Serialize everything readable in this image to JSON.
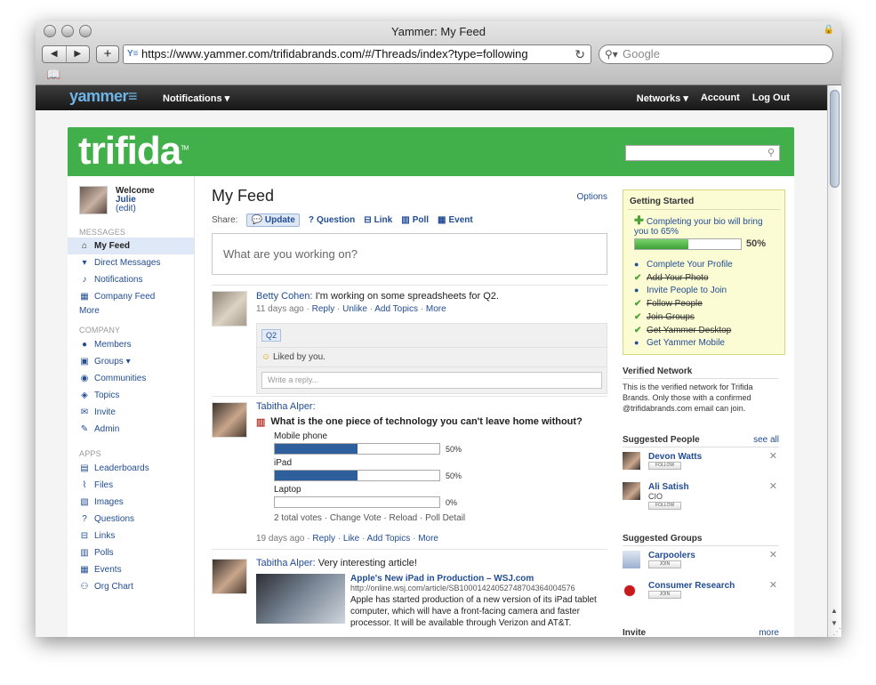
{
  "window": {
    "title": "Yammer: My Feed"
  },
  "browser": {
    "url": "https://www.yammer.com/trifidabrands.com/#/Threads/index?type=following",
    "search_placeholder": "Google",
    "back_label": "◀",
    "forward_label": "▶",
    "add_label": "+",
    "favicon_label": "Y≡",
    "reload_label": "↻",
    "bookmarks_label": "📖"
  },
  "topbar": {
    "logo": "yammer≡",
    "notifications": "Notifications ▾",
    "networks": "Networks ▾",
    "account": "Account",
    "logout": "Log Out"
  },
  "banner": {
    "brand": "trifida",
    "tm": "TM"
  },
  "user": {
    "welcome": "Welcome",
    "name": "Julie",
    "edit": "(edit)"
  },
  "sidebar": {
    "messages_header": "MESSAGES",
    "messages": [
      {
        "label": "My Feed",
        "icon": "house-icon",
        "glyph": "⌂"
      },
      {
        "label": "Direct Messages",
        "icon": "inbox-icon",
        "glyph": "▾"
      },
      {
        "label": "Notifications",
        "icon": "bell-icon",
        "glyph": "♪"
      },
      {
        "label": "Company Feed",
        "icon": "building-icon",
        "glyph": "▦"
      }
    ],
    "messages_more": "More",
    "company_header": "COMPANY",
    "company": [
      {
        "label": "Members",
        "icon": "person-icon",
        "glyph": "●"
      },
      {
        "label": "Groups ▾",
        "icon": "groups-icon",
        "glyph": "▣"
      },
      {
        "label": "Communities",
        "icon": "globe-icon",
        "glyph": "◉"
      },
      {
        "label": "Topics",
        "icon": "tag-icon",
        "glyph": "◈"
      },
      {
        "label": "Invite",
        "icon": "envelope-icon",
        "glyph": "✉"
      },
      {
        "label": "Admin",
        "icon": "wrench-icon",
        "glyph": "✎"
      }
    ],
    "apps_header": "APPS",
    "apps": [
      {
        "label": "Leaderboards",
        "icon": "leaderboard-icon",
        "glyph": "▤"
      },
      {
        "label": "Files",
        "icon": "paperclip-icon",
        "glyph": "⌇"
      },
      {
        "label": "Images",
        "icon": "image-icon",
        "glyph": "▧"
      },
      {
        "label": "Questions",
        "icon": "question-icon",
        "glyph": "?"
      },
      {
        "label": "Links",
        "icon": "link-icon",
        "glyph": "⊟"
      },
      {
        "label": "Polls",
        "icon": "poll-icon",
        "glyph": "▥"
      },
      {
        "label": "Events",
        "icon": "calendar-icon",
        "glyph": "▦"
      },
      {
        "label": "Org Chart",
        "icon": "orgchart-icon",
        "glyph": "⚇"
      }
    ]
  },
  "feed": {
    "title": "My Feed",
    "options": "Options",
    "share_label": "Share:",
    "share": [
      {
        "label": "Update",
        "icon": "update-icon",
        "glyph": "💬"
      },
      {
        "label": "Question",
        "icon": "question-icon",
        "glyph": "?"
      },
      {
        "label": "Link",
        "icon": "link-icon",
        "glyph": "⊟"
      },
      {
        "label": "Poll",
        "icon": "poll-icon",
        "glyph": "▥"
      },
      {
        "label": "Event",
        "icon": "calendar-icon",
        "glyph": "▦"
      }
    ],
    "composer_placeholder": "What are you working on?",
    "post1": {
      "author": "Betty Cohen:",
      "text": " I'm working on some spreadsheets for Q2.",
      "meta": "11 days ago · ",
      "actions": [
        "Reply",
        "Unlike",
        "Add Topics",
        "More"
      ],
      "tag": "Q2",
      "liked": "Liked by you.",
      "reply_placeholder": "Write a reply..."
    },
    "post2": {
      "author": "Tabitha Alper:",
      "question": "What is the one piece of technology you can't leave home without?",
      "options": [
        {
          "label": "Mobile phone",
          "value": 50,
          "pct": "50%"
        },
        {
          "label": "iPad",
          "value": 50,
          "pct": "50%"
        },
        {
          "label": "Laptop",
          "value": 0,
          "pct": "0%"
        }
      ],
      "votes": "2 total votes · ",
      "poll_actions": [
        "Change Vote",
        "Reload",
        "Poll Detail"
      ],
      "meta": "19 days ago · ",
      "actions": [
        "Reply",
        "Like",
        "Add Topics",
        "More"
      ]
    },
    "post3": {
      "author": "Tabitha Alper:",
      "text": " Very interesting article!",
      "article_title": "Apple's New iPad in Production – WSJ.com",
      "article_url": "http://online.wsj.com/article/SB10001424052748704364004576",
      "article_desc": "Apple has started production of a new version of its iPad tablet computer, which will have a front-facing camera and faster processor. It will be available through Verizon and AT&T."
    }
  },
  "getting_started": {
    "title": "Getting Started",
    "intro": "Completing your bio will bring you to 65%",
    "progress": 50,
    "progress_label": "50%",
    "items": [
      {
        "label": "Complete Your Profile",
        "done": false
      },
      {
        "label": "Add Your Photo",
        "done": true
      },
      {
        "label": "Invite People to Join",
        "done": false
      },
      {
        "label": "Follow People",
        "done": true
      },
      {
        "label": "Join Groups",
        "done": true
      },
      {
        "label": "Get Yammer Desktop",
        "done": true
      },
      {
        "label": "Get Yammer Mobile",
        "done": false
      }
    ]
  },
  "verified": {
    "title": "Verified Network",
    "text": "This is the verified network for Trifida Brands. Only those with a confirmed @trifidabrands.com email can join."
  },
  "suggested_people": {
    "title": "Suggested People",
    "see_all": "see all",
    "people": [
      {
        "name": "Devon Watts",
        "sub": "",
        "button": "FOLLOW"
      },
      {
        "name": "Ali Satish",
        "sub": "CIO",
        "button": "FOLLOW"
      }
    ]
  },
  "suggested_groups": {
    "title": "Suggested Groups",
    "groups": [
      {
        "name": "Carpoolers",
        "button": "JOIN"
      },
      {
        "name": "Consumer Research",
        "button": "JOIN"
      }
    ]
  },
  "invite": {
    "title": "Invite",
    "more": "more"
  }
}
